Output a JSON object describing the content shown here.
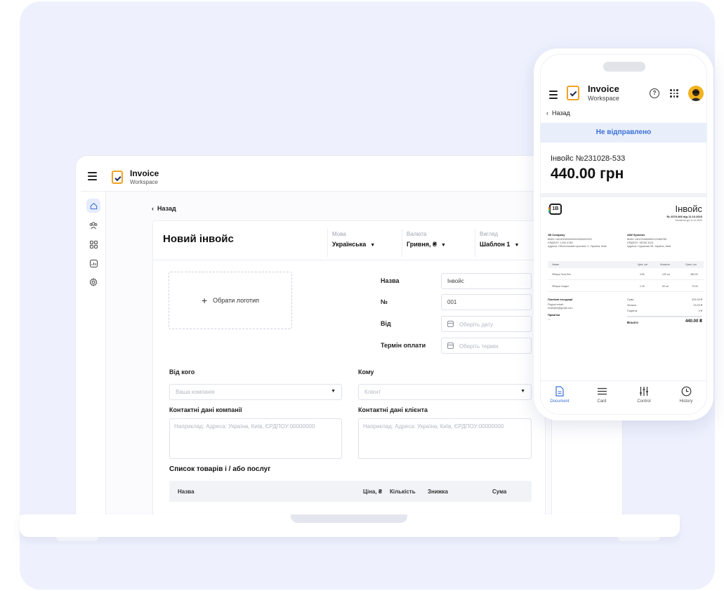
{
  "laptop": {
    "brand": {
      "title": "Invoice",
      "subtitle": "Workspace"
    },
    "back_label": "Назад",
    "form": {
      "title": "Новий інвойс",
      "selects": [
        {
          "label": "Мова",
          "value": "Українська"
        },
        {
          "label": "Валюта",
          "value": "Гривня, ₴"
        },
        {
          "label": "Вигляд",
          "value": "Шаблон 1"
        }
      ],
      "logo_button": "Обрати логотип",
      "meta": {
        "name_label": "Назва",
        "name_value": "Інвойс",
        "number_label": "№",
        "number_value": "001",
        "date_label": "Від",
        "date_placeholder": "Оберіть дату",
        "due_label": "Термін оплати",
        "due_placeholder": "Оберіть термін"
      },
      "from": {
        "label": "Від кого",
        "placeholder": "Ваша компанія"
      },
      "to": {
        "label": "Кому",
        "placeholder": "Клієнт"
      },
      "company_contacts": {
        "label": "Контактні дані компанії",
        "placeholder": "Наприклад: Адреса: Україна, Київ, ЄРДПОУ:00000000"
      },
      "client_contacts": {
        "label": "Контактні дані клієнта",
        "placeholder": "Наприклад: Адреса: Україна, Київ, ЄРДПОУ:00000000"
      },
      "items": {
        "title": "Список товарів і / або послуг",
        "columns": [
          "Назва",
          "Ціна, ₴",
          "Кількість",
          "Знижка",
          "Сума"
        ]
      }
    }
  },
  "phone": {
    "brand": {
      "title": "Invoice",
      "subtitle": "Workspace"
    },
    "help_glyph": "?",
    "back_label": "Назад",
    "status": "Не відправлено",
    "invoice_number": "Інвойс №231028-533",
    "amount": "440.00 грн",
    "preview": {
      "logo_text": "1B",
      "title": "Інвойс",
      "number": "№ 2378-466 від 11.10.2023",
      "due": "Оплатити до 11.11.2023",
      "from_company": "1B Company",
      "to_company": "AIW Systems",
      "from_lines": [
        "IBAN: UA1490000040000000000320",
        "ЄРДПОУ: 1234 4789",
        "Адреса: Оболонський проспект 1, Україна, Київ"
      ],
      "to_lines": [
        "IBAN: UA1234562890123456789",
        "ЄРДПОУ: 98765 4321",
        "Адреса: Сурикова 35, Україна, Київ"
      ],
      "columns": [
        "Назва",
        "Ціна, грн",
        "Кількість",
        "Сума, грн"
      ],
      "rows": [
        [
          "Яблука Гала білі",
          "3.80",
          "100 шт",
          "380.00"
        ],
        [
          "Яблука Голден",
          "1.00",
          "60 шт",
          "70.00"
        ]
      ],
      "payment_title": "Платіжні інструкції",
      "payment_lines": [
        "Paypal email:",
        "example@gmail.com"
      ],
      "notes_title": "Примітки",
      "notes_value": "—",
      "summary": [
        {
          "label": "Сума",
          "value": "405.00 ₴"
        },
        {
          "label": "Знижка",
          "value": "15.00 ₴"
        },
        {
          "label": "Податок",
          "value": "0 ₴"
        }
      ],
      "total_label": "Всього",
      "total_value": "440.00 ₴"
    },
    "tabs": [
      {
        "label": "Document",
        "icon": "document-icon",
        "active": true
      },
      {
        "label": "Card",
        "icon": "list-icon",
        "active": false
      },
      {
        "label": "Control",
        "icon": "sliders-icon",
        "active": false
      },
      {
        "label": "History",
        "icon": "clock-icon",
        "active": false
      }
    ]
  },
  "colors": {
    "accent": "#3b6fd6",
    "brand_orange": "#f2a326",
    "background": "#eef1fd"
  }
}
